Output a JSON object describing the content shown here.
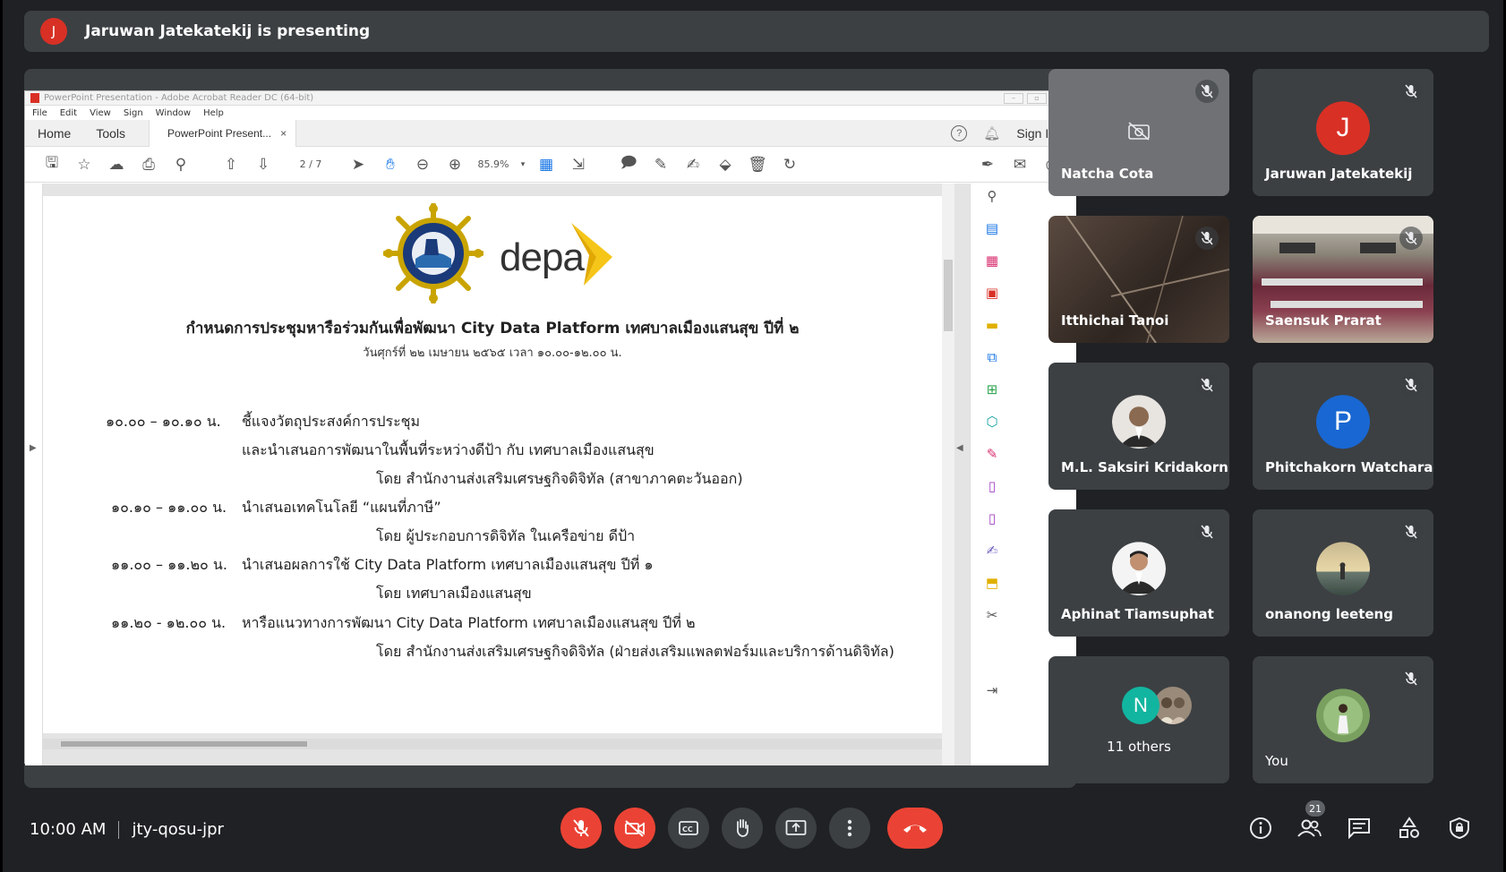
{
  "presenting": {
    "avatar_letter": "J",
    "text": "Jaruwan Jatekatekij is presenting"
  },
  "acrobat": {
    "window_title": "PowerPoint Presentation - Adobe Acrobat Reader DC (64-bit)",
    "menu": [
      "File",
      "Edit",
      "View",
      "Sign",
      "Window",
      "Help"
    ],
    "tabs": {
      "home": "Home",
      "tools": "Tools",
      "doc": "PowerPoint Present...",
      "close": "×"
    },
    "sign_in": "Sign In",
    "page_indicator": "2  /  7",
    "zoom": "85.9%"
  },
  "document": {
    "logo_text": "depa",
    "title": "กำหนดการประชุมหารือร่วมกันเพื่อพัฒนา City Data Platform เทศบาลเมืองแสนสุข ปีที่ ๒",
    "date": "วันศุกร์ที่ ๒๒ เมษายน ๒๕๖๕ เวลา ๑๐.๐๐-๑๒.๐๐ น.",
    "agenda": [
      {
        "time": "๑๐.๐๐ – ๑๐.๑๐ น.",
        "text": "ชี้แจงวัตถุประสงค์การประชุม"
      },
      {
        "time": "",
        "text": "และนำเสนอการพัฒนาในพื้นที่ระหว่างดีป้า กับ เทศบาลเมืองแสนสุข"
      },
      {
        "time": "",
        "text": "โดย สำนักงานส่งเสริมเศรษฐกิจดิจิทัล (สาขาภาคตะวันออก)"
      },
      {
        "time": "๑๐.๑๐ – ๑๑.๐๐ น.",
        "text": "นำเสนอเทคโนโลยี “แผนที่ภาษี”"
      },
      {
        "time": "",
        "text": "โดย ผู้ประกอบการดิจิทัล ในเครือข่าย ดีป้า"
      },
      {
        "time": "๑๑.๐๐ – ๑๑.๒๐ น.",
        "text": "นำเสนอผลการใช้ City Data Platform เทศบาลเมืองแสนสุข ปีที่ ๑"
      },
      {
        "time": "",
        "text": "โดย เทศบาลเมืองแสนสุข"
      },
      {
        "time": "๑๑.๒๐ - ๑๒.๐๐ น.",
        "text": "หารือแนวทางการพัฒนา City Data Platform เทศบาลเมืองแสนสุข ปีที่ ๒"
      },
      {
        "time": "",
        "text": "โดย สำนักงานส่งเสริมเศรษฐกิจดิจิทัล (ฝ่ายส่งเสริมแพลตฟอร์มและบริการด้านดิจิทัล)"
      }
    ]
  },
  "participants": [
    {
      "name": "Natcha Cota",
      "avatar": "camera-off"
    },
    {
      "name": "Jaruwan Jatekatekij",
      "avatar": "J",
      "color": "#d93025"
    },
    {
      "name": "Itthichai Tanoi",
      "avatar": "video"
    },
    {
      "name": "Saensuk Prarat",
      "avatar": "video"
    },
    {
      "name": "M.L. Saksiri Kridakorn",
      "avatar": "photo"
    },
    {
      "name": "Phitchakorn Watchara...",
      "avatar": "P",
      "color": "#1967d2"
    },
    {
      "name": "Aphinat Tiamsuphat",
      "avatar": "photo"
    },
    {
      "name": "onanong leeteng",
      "avatar": "photo"
    },
    {
      "name": "11 others",
      "avatar": "N",
      "color": "#12b5a0"
    },
    {
      "name": "You",
      "avatar": "photo"
    }
  ],
  "meeting": {
    "time": "10:00 AM",
    "code": "jty-qosu-jpr",
    "people_count": "21"
  },
  "colors": {
    "bg": "#202124",
    "tile": "#3c4043",
    "red": "#ea4335"
  }
}
